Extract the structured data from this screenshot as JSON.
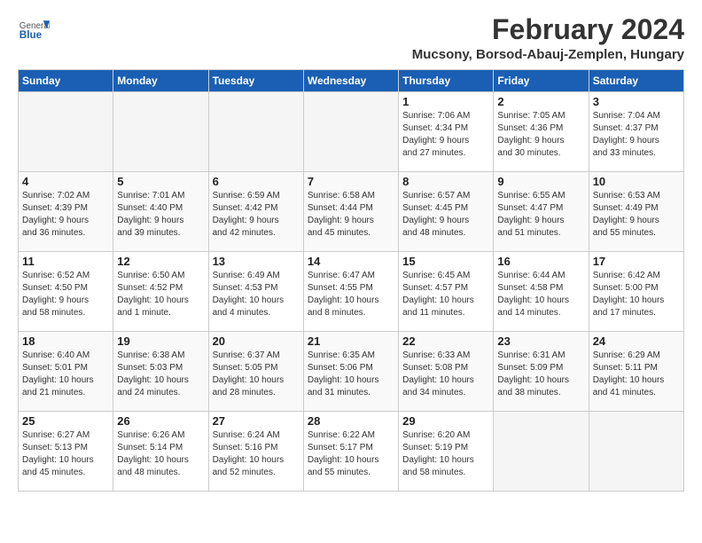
{
  "logo": {
    "general": "General",
    "blue": "Blue"
  },
  "title": "February 2024",
  "subtitle": "Mucsony, Borsod-Abauj-Zemplen, Hungary",
  "days_of_week": [
    "Sunday",
    "Monday",
    "Tuesday",
    "Wednesday",
    "Thursday",
    "Friday",
    "Saturday"
  ],
  "weeks": [
    [
      {
        "day": "",
        "info": ""
      },
      {
        "day": "",
        "info": ""
      },
      {
        "day": "",
        "info": ""
      },
      {
        "day": "",
        "info": ""
      },
      {
        "day": "1",
        "info": "Sunrise: 7:06 AM\nSunset: 4:34 PM\nDaylight: 9 hours\nand 27 minutes."
      },
      {
        "day": "2",
        "info": "Sunrise: 7:05 AM\nSunset: 4:36 PM\nDaylight: 9 hours\nand 30 minutes."
      },
      {
        "day": "3",
        "info": "Sunrise: 7:04 AM\nSunset: 4:37 PM\nDaylight: 9 hours\nand 33 minutes."
      }
    ],
    [
      {
        "day": "4",
        "info": "Sunrise: 7:02 AM\nSunset: 4:39 PM\nDaylight: 9 hours\nand 36 minutes."
      },
      {
        "day": "5",
        "info": "Sunrise: 7:01 AM\nSunset: 4:40 PM\nDaylight: 9 hours\nand 39 minutes."
      },
      {
        "day": "6",
        "info": "Sunrise: 6:59 AM\nSunset: 4:42 PM\nDaylight: 9 hours\nand 42 minutes."
      },
      {
        "day": "7",
        "info": "Sunrise: 6:58 AM\nSunset: 4:44 PM\nDaylight: 9 hours\nand 45 minutes."
      },
      {
        "day": "8",
        "info": "Sunrise: 6:57 AM\nSunset: 4:45 PM\nDaylight: 9 hours\nand 48 minutes."
      },
      {
        "day": "9",
        "info": "Sunrise: 6:55 AM\nSunset: 4:47 PM\nDaylight: 9 hours\nand 51 minutes."
      },
      {
        "day": "10",
        "info": "Sunrise: 6:53 AM\nSunset: 4:49 PM\nDaylight: 9 hours\nand 55 minutes."
      }
    ],
    [
      {
        "day": "11",
        "info": "Sunrise: 6:52 AM\nSunset: 4:50 PM\nDaylight: 9 hours\nand 58 minutes."
      },
      {
        "day": "12",
        "info": "Sunrise: 6:50 AM\nSunset: 4:52 PM\nDaylight: 10 hours\nand 1 minute."
      },
      {
        "day": "13",
        "info": "Sunrise: 6:49 AM\nSunset: 4:53 PM\nDaylight: 10 hours\nand 4 minutes."
      },
      {
        "day": "14",
        "info": "Sunrise: 6:47 AM\nSunset: 4:55 PM\nDaylight: 10 hours\nand 8 minutes."
      },
      {
        "day": "15",
        "info": "Sunrise: 6:45 AM\nSunset: 4:57 PM\nDaylight: 10 hours\nand 11 minutes."
      },
      {
        "day": "16",
        "info": "Sunrise: 6:44 AM\nSunset: 4:58 PM\nDaylight: 10 hours\nand 14 minutes."
      },
      {
        "day": "17",
        "info": "Sunrise: 6:42 AM\nSunset: 5:00 PM\nDaylight: 10 hours\nand 17 minutes."
      }
    ],
    [
      {
        "day": "18",
        "info": "Sunrise: 6:40 AM\nSunset: 5:01 PM\nDaylight: 10 hours\nand 21 minutes."
      },
      {
        "day": "19",
        "info": "Sunrise: 6:38 AM\nSunset: 5:03 PM\nDaylight: 10 hours\nand 24 minutes."
      },
      {
        "day": "20",
        "info": "Sunrise: 6:37 AM\nSunset: 5:05 PM\nDaylight: 10 hours\nand 28 minutes."
      },
      {
        "day": "21",
        "info": "Sunrise: 6:35 AM\nSunset: 5:06 PM\nDaylight: 10 hours\nand 31 minutes."
      },
      {
        "day": "22",
        "info": "Sunrise: 6:33 AM\nSunset: 5:08 PM\nDaylight: 10 hours\nand 34 minutes."
      },
      {
        "day": "23",
        "info": "Sunrise: 6:31 AM\nSunset: 5:09 PM\nDaylight: 10 hours\nand 38 minutes."
      },
      {
        "day": "24",
        "info": "Sunrise: 6:29 AM\nSunset: 5:11 PM\nDaylight: 10 hours\nand 41 minutes."
      }
    ],
    [
      {
        "day": "25",
        "info": "Sunrise: 6:27 AM\nSunset: 5:13 PM\nDaylight: 10 hours\nand 45 minutes."
      },
      {
        "day": "26",
        "info": "Sunrise: 6:26 AM\nSunset: 5:14 PM\nDaylight: 10 hours\nand 48 minutes."
      },
      {
        "day": "27",
        "info": "Sunrise: 6:24 AM\nSunset: 5:16 PM\nDaylight: 10 hours\nand 52 minutes."
      },
      {
        "day": "28",
        "info": "Sunrise: 6:22 AM\nSunset: 5:17 PM\nDaylight: 10 hours\nand 55 minutes."
      },
      {
        "day": "29",
        "info": "Sunrise: 6:20 AM\nSunset: 5:19 PM\nDaylight: 10 hours\nand 58 minutes."
      },
      {
        "day": "",
        "info": ""
      },
      {
        "day": "",
        "info": ""
      }
    ]
  ]
}
